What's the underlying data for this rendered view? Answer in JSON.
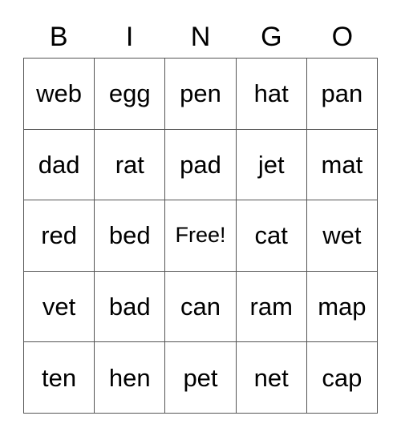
{
  "card": {
    "header_letters": [
      "B",
      "I",
      "N",
      "G",
      "O"
    ],
    "free_space_label": "Free!",
    "text_color": "#000000",
    "border_color": "#555555",
    "background_color": "#ffffff",
    "rows": [
      [
        "web",
        "egg",
        "pen",
        "hat",
        "pan"
      ],
      [
        "dad",
        "rat",
        "pad",
        "jet",
        "mat"
      ],
      [
        "red",
        "bed",
        "Free!",
        "cat",
        "wet"
      ],
      [
        "vet",
        "bad",
        "can",
        "ram",
        "map"
      ],
      [
        "ten",
        "hen",
        "pet",
        "net",
        "cap"
      ]
    ]
  }
}
